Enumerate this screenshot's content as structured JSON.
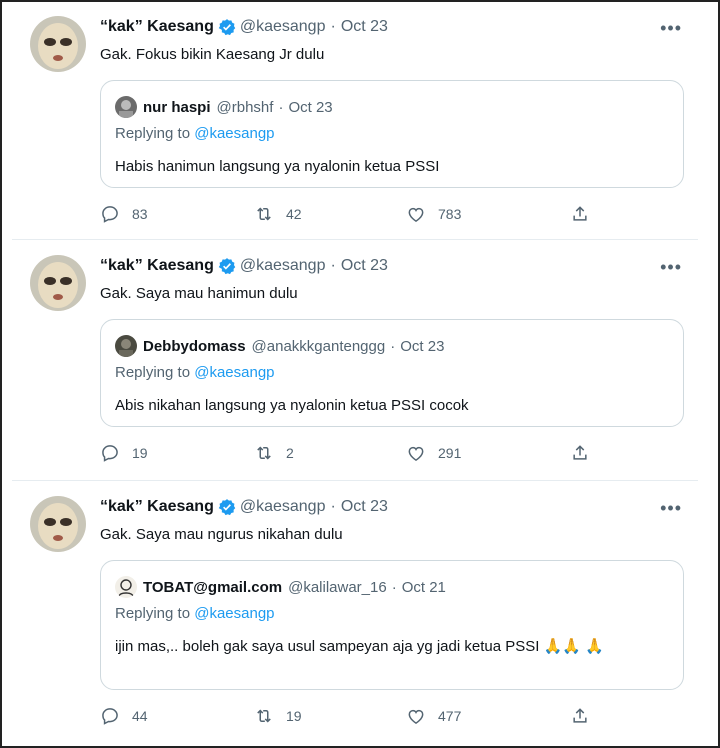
{
  "tweets": [
    {
      "author_name": "“kak” Kaesang",
      "handle": "@kaesangp",
      "date": "Oct 23",
      "text": "Gak. Fokus bikin Kaesang Jr dulu",
      "quote": {
        "name": "nur haspi",
        "handle": "@rbhshf",
        "date": "Oct 23",
        "replying_prefix": "Replying to",
        "replying_to": "@kaesangp",
        "text": "Habis hanimun langsung ya nyalonin ketua PSSI"
      },
      "replies": "83",
      "retweets": "42",
      "likes": "783"
    },
    {
      "author_name": "“kak” Kaesang",
      "handle": "@kaesangp",
      "date": "Oct 23",
      "text": "Gak. Saya mau hanimun dulu",
      "quote": {
        "name": "Debbydomass",
        "handle": "@anakkkgantenggg",
        "date": "Oct 23",
        "replying_prefix": "Replying to",
        "replying_to": "@kaesangp",
        "text": "Abis nikahan langsung ya nyalonin ketua PSSI cocok"
      },
      "replies": "19",
      "retweets": "2",
      "likes": "291"
    },
    {
      "author_name": "“kak” Kaesang",
      "handle": "@kaesangp",
      "date": "Oct 23",
      "text": "Gak. Saya mau ngurus nikahan dulu",
      "quote": {
        "name": "TOBAT@gmail.com",
        "handle": "@kalilawar_16",
        "date": "Oct 21",
        "replying_prefix": "Replying to",
        "replying_to": "@kaesangp",
        "text": "ijin mas,.. boleh gak saya usul sampeyan aja yg jadi ketua PSSI 🙏🙏 🙏"
      },
      "replies": "44",
      "retweets": "19",
      "likes": "477"
    }
  ],
  "separator": "·",
  "icons": {
    "verified": "verified-badge-icon",
    "more": "more-icon",
    "reply": "reply-icon",
    "retweet": "retweet-icon",
    "like": "heart-icon",
    "share": "share-icon"
  },
  "colors": {
    "accent": "#1d9bf0",
    "muted": "#536471",
    "text": "#0f1419",
    "border": "#cfd9de"
  }
}
